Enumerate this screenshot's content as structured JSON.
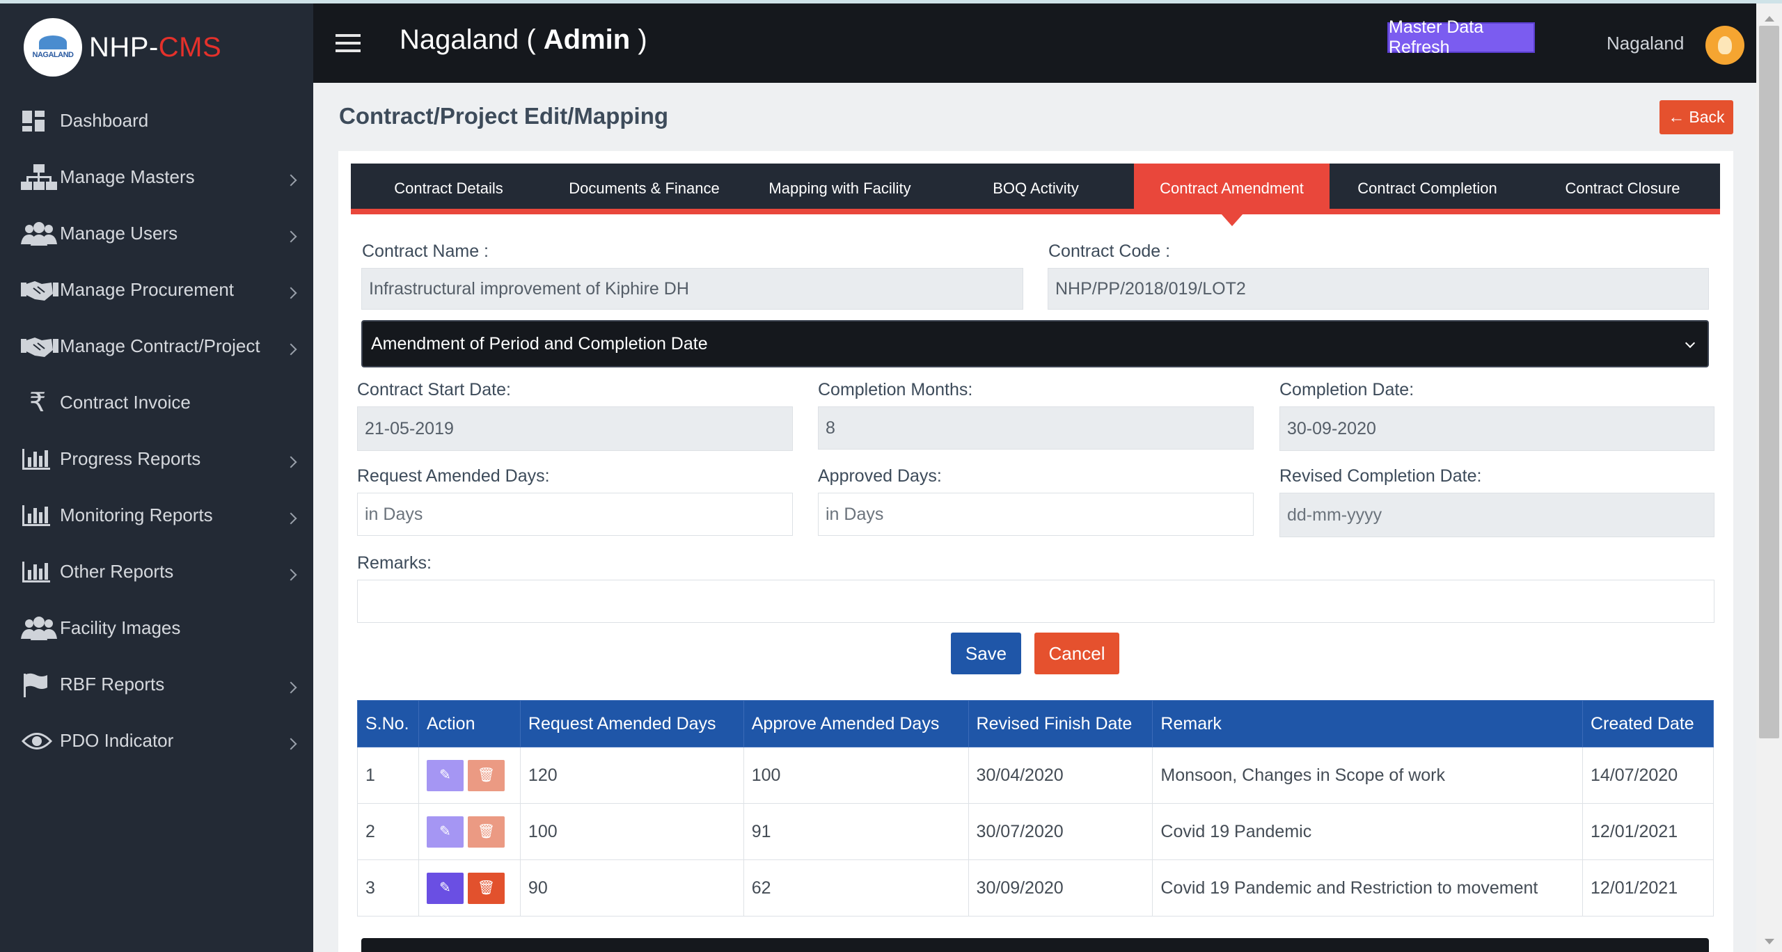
{
  "brand": {
    "logo_text": "NAGALAND",
    "name_prefix": "NHP-",
    "name_suffix": "CMS"
  },
  "sidebar": {
    "items": [
      {
        "label": "Dashboard",
        "icon": "dashboard-icon",
        "has_submenu": false
      },
      {
        "label": "Manage Masters",
        "icon": "sitemap-icon",
        "has_submenu": true
      },
      {
        "label": "Manage Users",
        "icon": "users-icon",
        "has_submenu": true
      },
      {
        "label": "Manage Procurement",
        "icon": "handshake-icon",
        "has_submenu": true
      },
      {
        "label": "Manage Contract/Project",
        "icon": "handshake-icon",
        "has_submenu": true
      },
      {
        "label": "Contract Invoice",
        "icon": "rupee-icon",
        "has_submenu": false
      },
      {
        "label": "Progress Reports",
        "icon": "bar-chart-icon",
        "has_submenu": true
      },
      {
        "label": "Monitoring Reports",
        "icon": "bar-chart-icon",
        "has_submenu": true
      },
      {
        "label": "Other Reports",
        "icon": "bar-chart-icon",
        "has_submenu": true
      },
      {
        "label": "Facility Images",
        "icon": "users-icon",
        "has_submenu": false
      },
      {
        "label": "RBF Reports",
        "icon": "flag-icon",
        "has_submenu": true
      },
      {
        "label": "PDO Indicator",
        "icon": "eye-icon",
        "has_submenu": true
      }
    ]
  },
  "header": {
    "title_prefix": "Nagaland ( ",
    "title_bold": "Admin",
    "title_suffix": " )",
    "master_refresh_label": "Master Data Refresh",
    "user_name": "Nagaland"
  },
  "page": {
    "title": "Contract/Project Edit/Mapping",
    "back_label": "Back"
  },
  "tabs": [
    {
      "label": "Contract Details",
      "active": false
    },
    {
      "label": "Documents & Finance",
      "active": false
    },
    {
      "label": "Mapping with Facility",
      "active": false
    },
    {
      "label": "BOQ Activity",
      "active": false
    },
    {
      "label": "Contract Amendment",
      "active": true
    },
    {
      "label": "Contract Completion",
      "active": false
    },
    {
      "label": "Contract Closure",
      "active": false
    }
  ],
  "form": {
    "contract_name_label": "Contract Name :",
    "contract_name_value": "Infrastructural improvement of Kiphire DH",
    "contract_code_label": "Contract Code :",
    "contract_code_value": "NHP/PP/2018/019/LOT2",
    "amendment_type": "Amendment of Period and Completion Date",
    "start_date_label": "Contract Start Date:",
    "start_date_value": "21-05-2019",
    "completion_months_label": "Completion Months:",
    "completion_months_value": "8",
    "completion_date_label": "Completion Date:",
    "completion_date_value": "30-09-2020",
    "request_days_label": "Request Amended Days:",
    "request_days_placeholder": "in Days",
    "approved_days_label": "Approved Days:",
    "approved_days_placeholder": "in Days",
    "revised_date_label": "Revised Completion Date:",
    "revised_date_placeholder": "dd-mm-yyyy",
    "remarks_label": "Remarks:",
    "save_label": "Save",
    "cancel_label": "Cancel"
  },
  "table": {
    "headers": [
      "S.No.",
      "Action",
      "Request Amended Days",
      "Approve Amended Days",
      "Revised Finish Date",
      "Remark",
      "Created Date"
    ],
    "rows": [
      {
        "sno": "1",
        "req_days": "120",
        "appr_days": "100",
        "revised": "30/04/2020",
        "remark": "Monsoon, Changes in Scope of work",
        "created": "14/07/2020"
      },
      {
        "sno": "2",
        "req_days": "100",
        "appr_days": "91",
        "revised": "30/07/2020",
        "remark": "Covid 19 Pandemic",
        "created": "12/01/2021"
      },
      {
        "sno": "3",
        "req_days": "90",
        "appr_days": "62",
        "revised": "30/09/2020",
        "remark": "Covid 19 Pandemic and Restriction to movement",
        "created": "12/01/2021"
      }
    ]
  },
  "colors": {
    "sidebar_bg": "#232a35",
    "header_bg": "#15181d",
    "tab_active": "#e9473b",
    "table_header": "#1f56a8",
    "save_button": "#1f56a8",
    "cancel_button": "#e5512e",
    "master_refresh": "#7b5cf0"
  }
}
